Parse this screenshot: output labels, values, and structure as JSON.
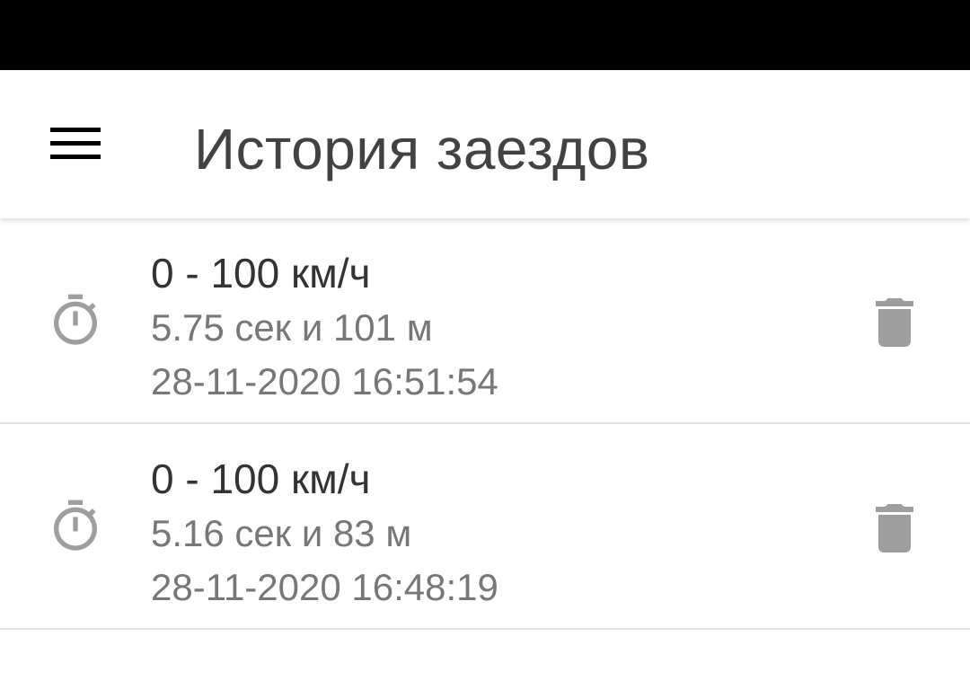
{
  "app_bar": {
    "title": "История заездов",
    "menu_icon": "hamburger-menu-icon"
  },
  "colors": {
    "status_bar": "#000000",
    "title_text": "#424242",
    "primary_text": "#333333",
    "secondary_text": "#777777",
    "icon_gray": "#9e9e9e",
    "divider": "#e3e3e3"
  },
  "runs": [
    {
      "title": "0 - 100 км/ч",
      "result": "5.75 сек и 101 м",
      "datetime": "28-11-2020 16:51:54",
      "leading_icon": "stopwatch-icon",
      "trailing_icon": "trash-icon"
    },
    {
      "title": "0 - 100 км/ч",
      "result": "5.16 сек и 83 м",
      "datetime": "28-11-2020 16:48:19",
      "leading_icon": "stopwatch-icon",
      "trailing_icon": "trash-icon"
    }
  ]
}
